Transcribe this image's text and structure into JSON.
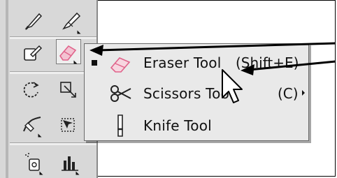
{
  "colors": {
    "panel_bg": "#d8d8d8",
    "menu_bg": "#e9e9e9",
    "eraser_pink": "#e0628a",
    "annotation": "#000000"
  },
  "toolbar": {
    "tools": [
      {
        "name": "paintbrush-icon"
      },
      {
        "name": "blob-brush-icon"
      },
      {
        "name": "shaper-icon"
      },
      {
        "name": "eraser-icon",
        "active": true
      },
      {
        "name": "rotate-icon"
      },
      {
        "name": "scale-icon"
      },
      {
        "name": "width-icon"
      },
      {
        "name": "free-transform-icon"
      },
      {
        "name": "symbol-sprayer-icon"
      },
      {
        "name": "column-graph-icon"
      }
    ]
  },
  "flyout": {
    "items": [
      {
        "label": "Eraser Tool",
        "shortcut": "(Shift+E)",
        "selected": true,
        "icon": "eraser-icon"
      },
      {
        "label": "Scissors Tool",
        "shortcut": "(C)",
        "selected": false,
        "icon": "scissors-icon"
      },
      {
        "label": "Knife Tool",
        "shortcut": "",
        "selected": false,
        "icon": "knife-icon"
      }
    ]
  }
}
